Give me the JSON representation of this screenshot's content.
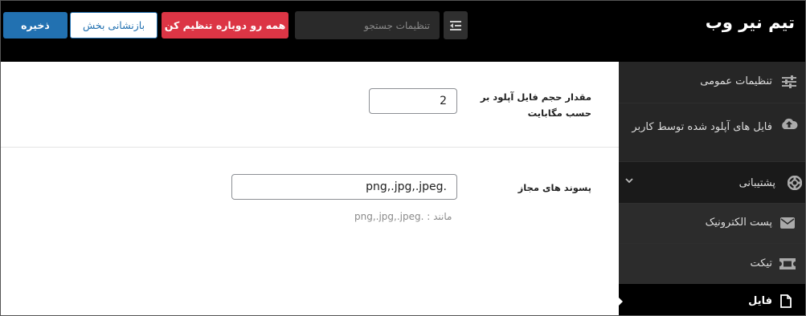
{
  "header": {
    "title": "تیم نیر وب",
    "search_placeholder": "تنظیمات جستجو",
    "reset_all_label": "همه رو دوباره تنظیم کن",
    "reset_section_label": "بازنشانی بخش",
    "save_label": "ذخیره"
  },
  "fields": {
    "upload_size": {
      "label": "مقدار حجم فایل آپلود بر حسب مگابایت",
      "value": "2"
    },
    "allowed_ext": {
      "label": "پسوند های مجاز",
      "value": ".png,.jpg,.jpeg",
      "hint": "مانند : .png,.jpg,.jpeg"
    }
  },
  "sidebar": {
    "items": [
      {
        "label": "تنظیمات عمومی",
        "icon": "sliders-icon"
      },
      {
        "label": "فایل های آپلود شده توسط کاربر",
        "icon": "cloud-upload-icon"
      },
      {
        "label": "پشتیبانی",
        "icon": "lifebuoy-icon"
      },
      {
        "label": "پست الکترونیک",
        "icon": "envelope-icon"
      },
      {
        "label": "تیکت",
        "icon": "ticket-icon"
      },
      {
        "label": "فایل",
        "icon": "file-icon"
      }
    ]
  },
  "colors": {
    "primary": "#2271b1",
    "danger": "#dc3545",
    "header_bg": "#000000",
    "sidebar_bg": "#1e1e1e"
  }
}
